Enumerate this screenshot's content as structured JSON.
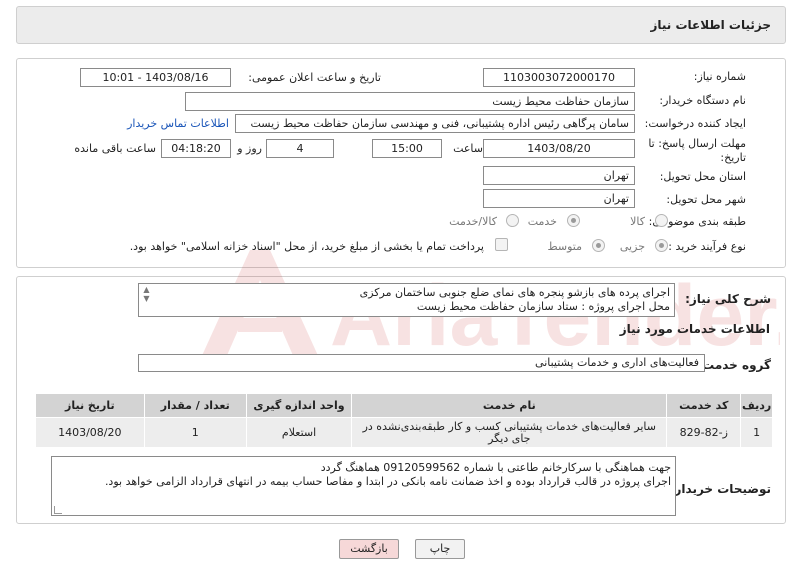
{
  "header": {
    "title": "جزئیات اطلاعات نیاز"
  },
  "form": {
    "need_number_label": "شماره نیاز:",
    "need_number": "1103003072000170",
    "announce_label": "تاریخ و ساعت اعلان عمومی:",
    "announce_value": "1403/08/16 - 10:01",
    "buyer_org_label": "نام دستگاه خریدار:",
    "buyer_org": "سازمان حفاظت محیط زیست",
    "requester_label": "ایجاد کننده درخواست:",
    "requester": "سامان پرگاهی رئیس اداره پشتیبانی، فنی و مهندسی سازمان حفاظت محیط زیست",
    "contact_link": "اطلاعات تماس خریدار",
    "deadline_label_1": "مهلت ارسال پاسخ: تا",
    "deadline_label_2": "تاریخ:",
    "deadline_date": "1403/08/20",
    "time_label": "ساعت",
    "deadline_time": "15:00",
    "days_value": "4",
    "days_label": "روز و",
    "remaining_time": "04:18:20",
    "remaining_label": "ساعت باقی مانده",
    "province_label": "استان محل تحویل:",
    "province": "تهران",
    "city_label": "شهر محل تحویل:",
    "city": "تهران",
    "category_label": "طبقه بندی موضوعی:",
    "category_options": [
      "کالا",
      "خدمت",
      "کالا/خدمت"
    ],
    "category_selected": "خدمت",
    "process_label": "نوع فرآیند خرید :",
    "process_options": [
      "جزیی",
      "متوسط"
    ],
    "process_selected": "جزیی",
    "payment_note": "پرداخت تمام یا بخشی از مبلغ خرید، از محل \"اسناد خزانه اسلامی\" خواهد بود."
  },
  "description": {
    "label": "شرح کلی نیاز:",
    "line1": "اجرای پرده های بازشو پنجره های نمای ضلع جنوبی ساختمان مرکزی",
    "line2": "محل اجرای پروژه : ستاد سازمان حفاظت محیط زیست"
  },
  "services": {
    "section_title": "اطلاعات خدمات مورد نیاز",
    "group_label": "گروه خدمت:",
    "group_value": "فعالیت‌های اداری و خدمات پشتیبانی",
    "columns": [
      "ردیف",
      "کد خدمت",
      "نام خدمت",
      "واحد اندازه گیری",
      "تعداد / مقدار",
      "تاریخ نیاز"
    ],
    "rows": [
      {
        "row": "1",
        "code": "ز-82-829",
        "name": "سایر فعالیت‌های خدمات پشتیبانی کسب و کار طبقه‌بندی‌نشده در جای دیگر",
        "unit": "استعلام",
        "qty": "1",
        "date": "1403/08/20"
      }
    ]
  },
  "buyer_notes": {
    "label": "توضیحات خریدار:",
    "line1": "جهت هماهنگی با سرکارخانم طاعتی با شماره 09120599562 هماهنگ گردد",
    "line2": "اجرای پروژه در قالب قرارداد بوده و اخذ ضمانت نامه بانکی در ابتدا و مفاصا حساب بیمه در انتهای قرارداد الزامی خواهد بود."
  },
  "buttons": {
    "print": "چاپ",
    "back": "بازگشت"
  },
  "watermark": {
    "text": "AriaTender.neT"
  },
  "colors": {
    "back_button_bg": "#f6d8d8",
    "link": "#1a55b8",
    "watermark": "#c62828"
  }
}
